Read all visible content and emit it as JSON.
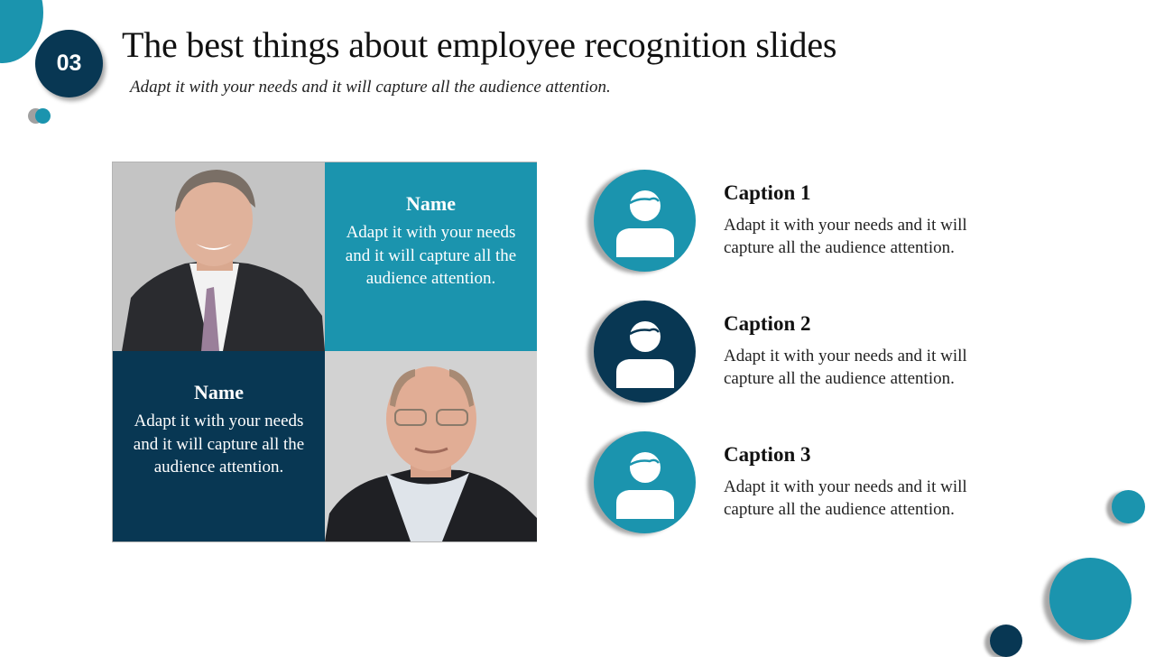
{
  "slide": {
    "number": "03",
    "title": "The best things about employee recognition slides",
    "subtitle": "Adapt it with your needs and it will capture all the audience attention."
  },
  "colors": {
    "teal": "#1b94ae",
    "navy": "#083753",
    "text": "#111111"
  },
  "profiles": [
    {
      "name": "Name",
      "description": "Adapt it with your needs and it will capture all the audience attention.",
      "panel_color": "teal",
      "photo": "man-in-suit-with-plaid-tie-photo"
    },
    {
      "name": "Name",
      "description": "Adapt it with your needs and it will capture all the audience attention.",
      "panel_color": "navy",
      "photo": "bald-man-with-glasses-photo"
    }
  ],
  "captions": [
    {
      "title": "Caption 1",
      "description": "Adapt it with your needs and it will capture all the audience attention.",
      "icon": "person-icon",
      "color": "teal"
    },
    {
      "title": "Caption 2",
      "description": "Adapt it with your needs and it will capture all the audience attention.",
      "icon": "person-icon",
      "color": "navy"
    },
    {
      "title": "Caption 3",
      "description": "Adapt it with your needs and it will capture all the audience attention.",
      "icon": "person-icon",
      "color": "teal"
    }
  ]
}
